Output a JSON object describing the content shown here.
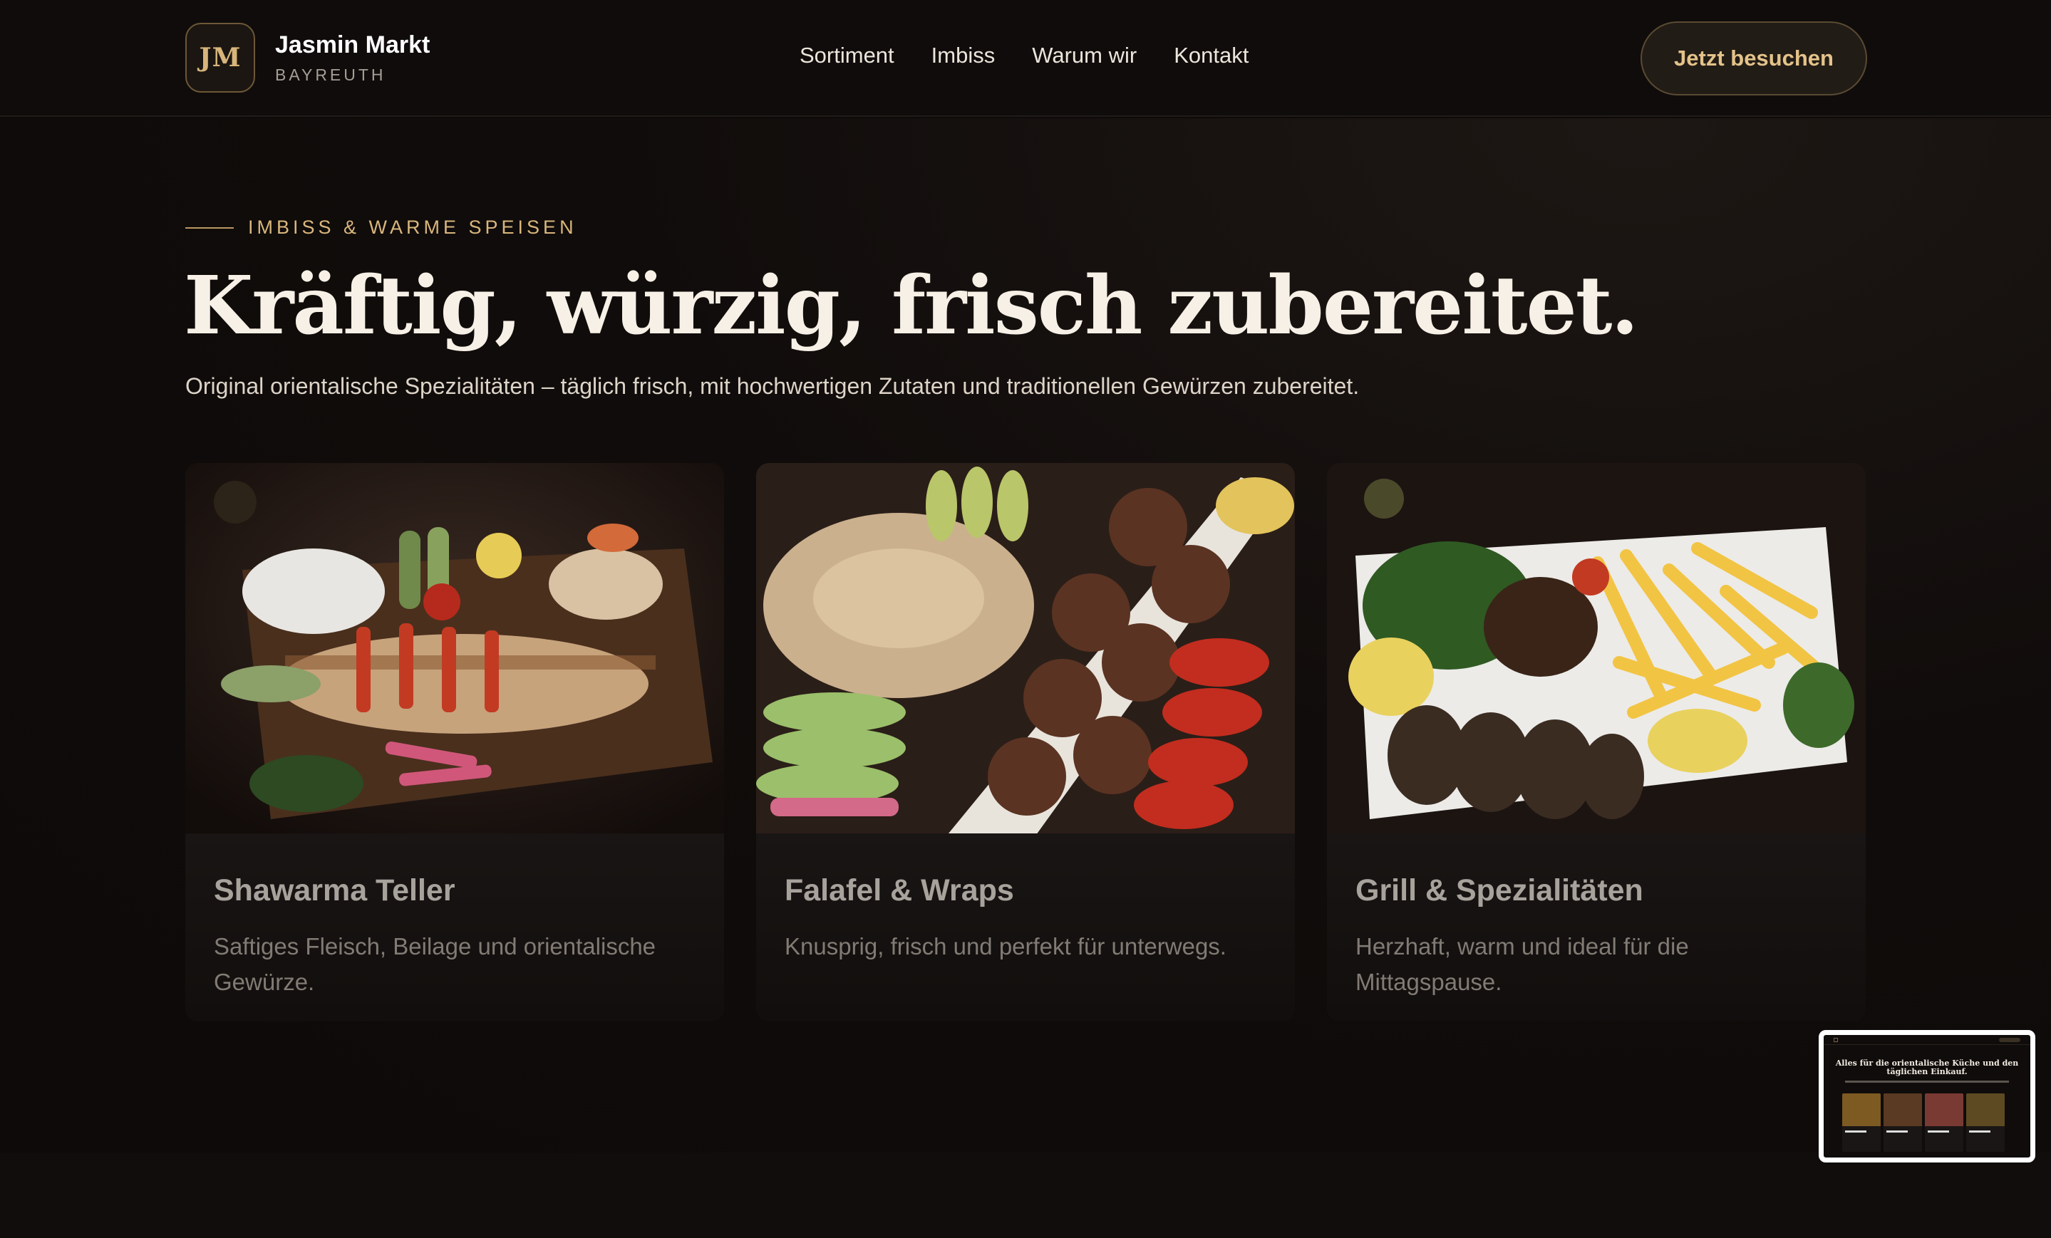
{
  "header": {
    "logo_mark": "JM",
    "brand_name": "Jasmin Markt",
    "brand_location": "BAYREUTH",
    "nav": [
      {
        "label": "Sortiment"
      },
      {
        "label": "Imbiss"
      },
      {
        "label": "Warum wir"
      },
      {
        "label": "Kontakt"
      }
    ],
    "cta_label": "Jetzt besuchen"
  },
  "hero": {
    "eyebrow": "IMBISS & WARME SPEISEN",
    "headline": "Kräftig, würzig, frisch zubereitet.",
    "subline": "Original orientalische Spezialitäten – täglich frisch, mit hochwertigen Zutaten und traditionellen Gewürzen zubereitet."
  },
  "cards": [
    {
      "title": "Shawarma Teller",
      "description": "Saftiges Fleisch, Beilage und orientalische Gewürze."
    },
    {
      "title": "Falafel & Wraps",
      "description": "Knusprig, frisch und perfekt für unterwegs."
    },
    {
      "title": "Grill & Spezialitäten",
      "description": "Herzhaft, warm und ideal für die Mittagspause."
    }
  ],
  "preview": {
    "title": "Alles für die orientalische Küche und den täglichen Einkauf."
  },
  "colors": {
    "background": "#0d0a09",
    "accent_gold": "#d9b67c",
    "text_light": "#f7f0e6"
  }
}
